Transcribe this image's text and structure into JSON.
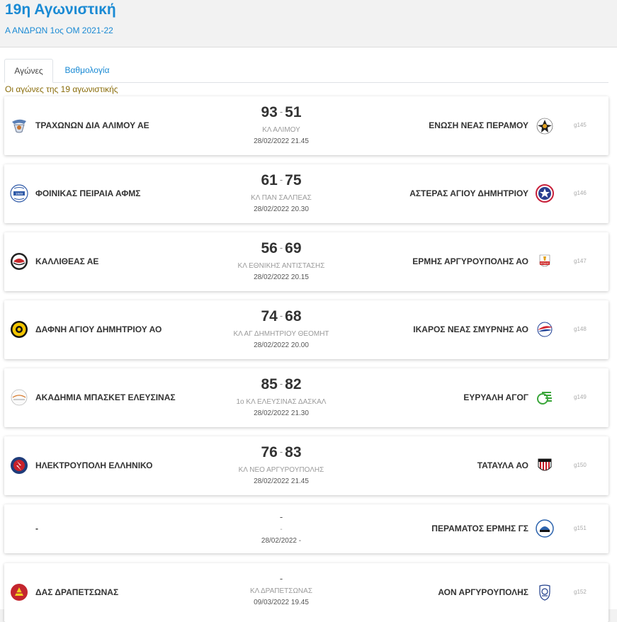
{
  "header": {
    "title": "19η Αγωνιστική",
    "subtitle": "Α ΑΝΔΡΩΝ 1ος ΟΜ 2021-22"
  },
  "tabs": [
    {
      "label": "Αγώνες",
      "active": true
    },
    {
      "label": "Βαθμολογία",
      "active": false
    }
  ],
  "list_caption": "Οι αγώνες της 19 αγωνιστικής",
  "matches": [
    {
      "home": "ΤΡΑΧΩΝΩΝ ΔΙΑ ΑΛΙΜΟΥ ΑΕ",
      "away": "ΕΝΩΣΗ ΝΕΑΣ ΠΕΡΑΜΟΥ",
      "home_score": "93",
      "away_score": "51",
      "venue": "ΚΛ ΑΛΙΜΟΥ",
      "datetime": "28/02/2022 21.45",
      "code": "g145"
    },
    {
      "home": "ΦΟΙΝΙΚΑΣ ΠΕΙΡΑΙΑ ΑΦΜΣ",
      "away": "ΑΣΤΕΡΑΣ ΑΓΙΟΥ ΔΗΜΗΤΡΙΟΥ",
      "home_score": "61",
      "away_score": "75",
      "venue": "ΚΛ ΠΑΝ ΣΑΛΠΕΑΣ",
      "datetime": "28/02/2022 20.30",
      "code": "g146"
    },
    {
      "home": "ΚΑΛΛΙΘΕΑΣ ΑΕ",
      "away": "ΕΡΜΗΣ ΑΡΓΥΡΟΥΠΟΛΗΣ ΑΟ",
      "home_score": "56",
      "away_score": "69",
      "venue": "ΚΛ ΕΘΝΙΚΗΣ ΑΝΤΙΣΤΑΣΗΣ",
      "datetime": "28/02/2022 20.15",
      "code": "g147"
    },
    {
      "home": "ΔΑΦΝΗ ΑΓΙΟΥ ΔΗΜΗΤΡΙΟΥ ΑΟ",
      "away": "ΙΚΑΡΟΣ ΝΕΑΣ ΣΜΥΡΝΗΣ ΑΟ",
      "home_score": "74",
      "away_score": "68",
      "venue": "ΚΛ ΑΓ ΔΗΜΗΤΡΙΟΥ ΘΕΟΜΗΤ",
      "datetime": "28/02/2022 20.00",
      "code": "g148"
    },
    {
      "home": "ΑΚΑΔΗΜΙΑ ΜΠΑΣΚΕΤ ΕΛΕΥΣΙΝΑΣ",
      "away": "ΕΥΡΥΑΛΗ ΑΓΟΓ",
      "home_score": "85",
      "away_score": "82",
      "venue": "1ο ΚΛ ΕΛΕΥΣΙΝΑΣ ΔΑΣΚΑΛ",
      "datetime": "28/02/2022 21.30",
      "code": "g149"
    },
    {
      "home": "ΗΛΕΚΤΡΟΥΠΟΛΗ ΕΛΛΗΝΙΚΟ",
      "away": "ΤΑΤΑΥΛΑ ΑΟ",
      "home_score": "76",
      "away_score": "83",
      "venue": "ΚΛ ΝΕΟ ΑΡΓΥΡΟΥΠΟΛΗΣ",
      "datetime": "28/02/2022 21.45",
      "code": "g150"
    },
    {
      "home": "-",
      "away": "ΠΕΡΑΜΑΤΟΣ ΕΡΜΗΣ ΓΣ",
      "score_text": "-",
      "venue": "-",
      "datetime": "28/02/2022 -",
      "code": "g151"
    },
    {
      "home": "ΔΑΣ ΔΡΑΠΕΤΣΩΝΑΣ",
      "away": "ΑΟΝ ΑΡΓΥΡΟΥΠΟΛΗΣ",
      "score_text": "-",
      "venue": "ΚΛ ΔΡΑΠΕΤΣΩΝΑΣ",
      "datetime": "09/03/2022 19.45",
      "code": "g152"
    }
  ],
  "icons": {
    "home": [
      "trachones-logo-icon",
      "foinikas-logo-icon",
      "kallithea-logo-icon",
      "dafni-logo-icon",
      "akadimia-logo-icon",
      "ilektroupoli-logo-icon",
      "",
      "drapetsona-logo-icon"
    ],
    "away": [
      "perama-logo-icon",
      "asteras-logo-icon",
      "ermis-logo-icon",
      "ikaros-logo-icon",
      "evryali-logo-icon",
      "tataula-logo-icon",
      "peramatos-logo-icon",
      "aon-logo-icon"
    ]
  },
  "colors": {
    "accent": "#1a8ad4",
    "caption": "#8a6d0b"
  }
}
